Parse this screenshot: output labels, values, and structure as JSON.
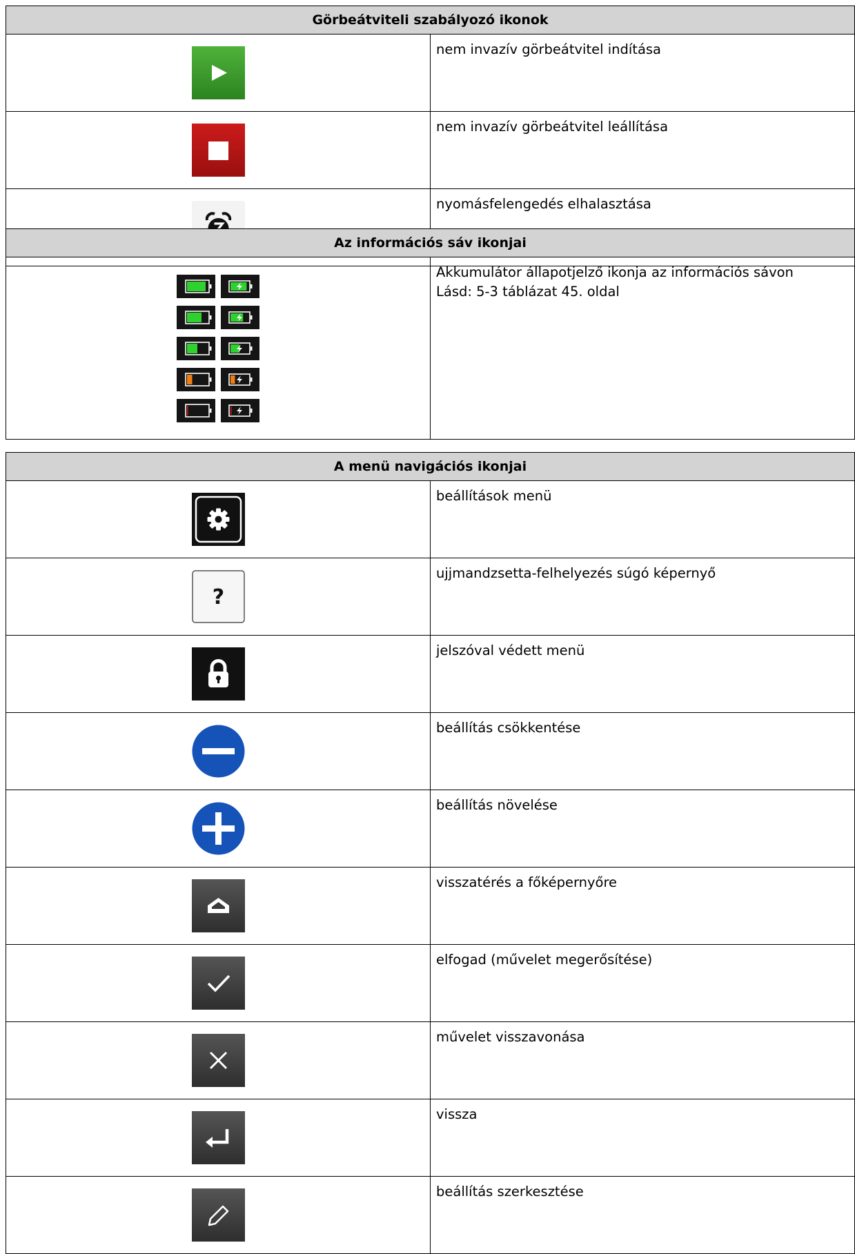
{
  "sections": [
    {
      "header": "Görbeátviteli szabályozó ikonok",
      "rows": [
        {
          "icon": "play-icon",
          "text": "nem invazív görbeátvitel indítása"
        },
        {
          "icon": "stop-icon",
          "text": "nem invazív görbeátvitel leállítása"
        },
        {
          "icon": "snooze-alarm-icon",
          "text": "nyomásfelengedés elhalasztása"
        }
      ]
    },
    {
      "header": "Az információs sáv ikonjai",
      "rows": [
        {
          "icon": "battery-status-icons",
          "lines": [
            "Akkumulátor állapotjelző ikonja az információs sávon",
            "Lásd: 5-3 táblázat 45. oldal"
          ]
        }
      ]
    },
    {
      "header": "A menü navigációs ikonjai",
      "rows": [
        {
          "icon": "settings-gear-icon",
          "text": "beállítások menü"
        },
        {
          "icon": "help-question-icon",
          "text": "ujjmandzsetta-felhelyezés súgó képernyő"
        },
        {
          "icon": "lock-icon",
          "text": "jelszóval védett menü"
        },
        {
          "icon": "minus-icon",
          "text": "beállítás csökkentése"
        },
        {
          "icon": "plus-icon",
          "text": "beállítás növelése"
        },
        {
          "icon": "home-icon",
          "text": "visszatérés a főképernyőre"
        },
        {
          "icon": "check-icon",
          "text": "elfogad (művelet megerősítése)"
        },
        {
          "icon": "close-icon",
          "text": "művelet visszavonása"
        },
        {
          "icon": "return-arrow-icon",
          "text": "vissza"
        },
        {
          "icon": "pencil-icon",
          "text": "beállítás szerkesztése"
        }
      ]
    }
  ],
  "colors": {
    "header_bg": "#d3d3d3",
    "play_green": "#3a9a2a",
    "stop_red": "#b41414",
    "minus_plus_blue": "#1553b8",
    "dark_tile": "#3a3a3a",
    "battery_green": "#2fd12f",
    "battery_orange": "#f07d10",
    "battery_red": "#e01414"
  },
  "battery_levels": [
    {
      "fill": 0.9,
      "color": "green"
    },
    {
      "fill": 0.7,
      "color": "green"
    },
    {
      "fill": 0.5,
      "color": "green"
    },
    {
      "fill": 0.25,
      "color": "orange"
    },
    {
      "fill": 0.05,
      "color": "red"
    }
  ]
}
